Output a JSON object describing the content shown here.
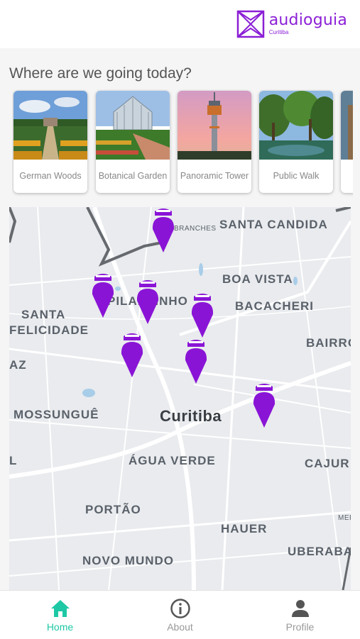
{
  "header": {
    "logo_title": "audioguia",
    "logo_subtitle": "Curitiba"
  },
  "question": "Where are we going today?",
  "places": [
    {
      "label": "German Woods"
    },
    {
      "label": "Botanical Garden"
    },
    {
      "label": "Panoramic Tower"
    },
    {
      "label": "Public Walk"
    }
  ],
  "map": {
    "labels": {
      "branches": "BRANCHES",
      "santa_candida": "SANTA CANDIDA",
      "boa_vista": "BOA VISTA",
      "pilarzinho": "PILARZINHO",
      "bacacheri": "BACACHERI",
      "santa": "SANTA",
      "felicidade": "FELICIDADE",
      "bairro": "BAIRRO",
      "az": "AZ",
      "mossungue": "MOSSUNGUÊ",
      "curitiba": "Curitiba",
      "l": "L",
      "agua_verde": "ÁGUA VERDE",
      "cajuru": "CAJUR",
      "portao": "PORTÃO",
      "hauer": "HAUER",
      "mer": "MER",
      "novo_mundo": "NOVO MUNDO",
      "uberaba": "UBERABA"
    },
    "pin_color": "#8a14d6",
    "pin_count": 8
  },
  "tabs": {
    "home": "Home",
    "about": "About",
    "profile": "Profile",
    "active_color": "#1ec8a5"
  }
}
